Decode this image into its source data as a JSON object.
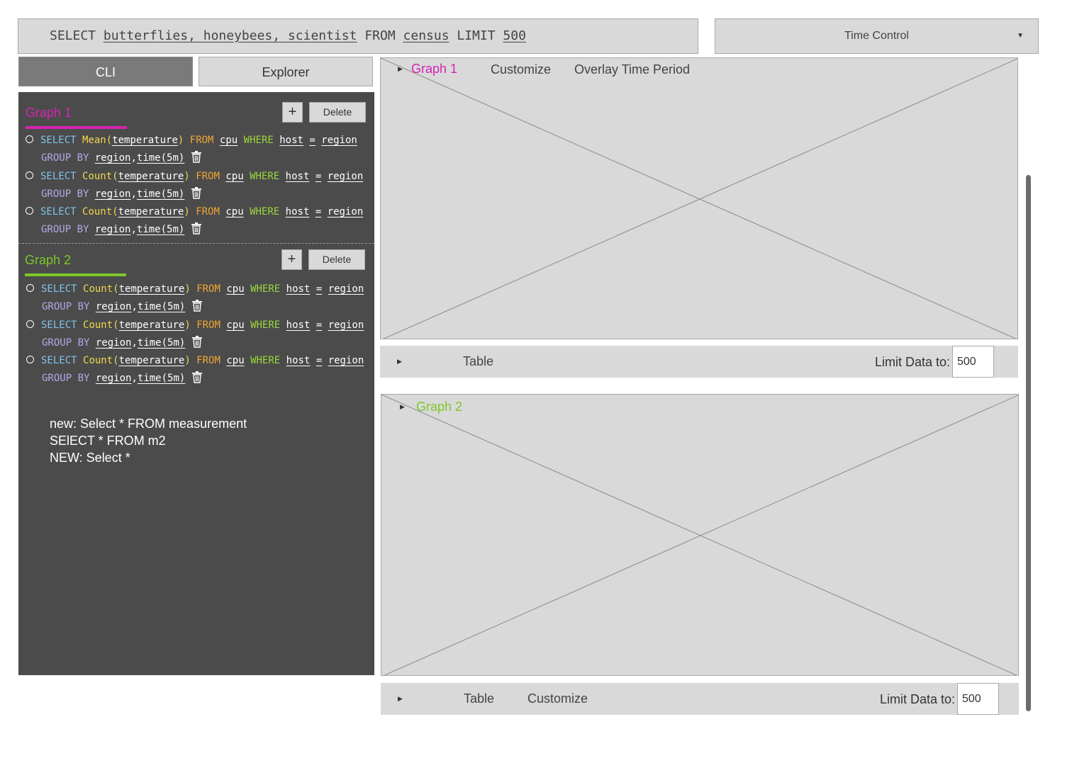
{
  "query_bar": {
    "parts": [
      "SELECT ",
      "butterflies, honeybees, scientist",
      " FROM ",
      "census",
      " LIMIT ",
      "500"
    ]
  },
  "time_control": {
    "label": "Time Control",
    "icon": "caret-down-icon"
  },
  "tabs": {
    "cli": "CLI",
    "explorer": "Explorer"
  },
  "colors": {
    "graph1": "#d424b4",
    "graph2": "#7cc828",
    "panel_bg": "#4b4b4b"
  },
  "cli": {
    "add_label": "+",
    "delete_label": "Delete",
    "groups": [
      {
        "title": "Graph 1",
        "queries": [
          {
            "select": "SELECT",
            "fn": "Mean(",
            "field": "temperature",
            "close": ")",
            "from": "FROM",
            "measurement": "cpu",
            "where": "WHERE",
            "tag": "host",
            "op": "=",
            "value": "region",
            "group": "GROUP BY",
            "g1": "region",
            "comma": ",",
            "g2": "time(5m)"
          },
          {
            "select": "SELECT",
            "fn": "Count(",
            "field": "temperature",
            "close": ")",
            "from": "FROM",
            "measurement": "cpu",
            "where": "WHERE",
            "tag": "host",
            "op": "=",
            "value": "region",
            "group": "GROUP BY",
            "g1": "region",
            "comma": ",",
            "g2": "time(5m)"
          },
          {
            "select": "SELECT",
            "fn": "Count(",
            "field": "temperature",
            "close": ")",
            "from": "FROM",
            "measurement": "cpu",
            "where": "WHERE",
            "tag": "host",
            "op": "=",
            "value": "region",
            "group": "GROUP BY",
            "g1": "region",
            "comma": ",",
            "g2": "time(5m)"
          }
        ]
      },
      {
        "title": "Graph 2",
        "queries": [
          {
            "select": "SELECT",
            "fn": "Count(",
            "field": "temperature",
            "close": ")",
            "from": "FROM",
            "measurement": "cpu",
            "where": "WHERE",
            "tag": "host",
            "op": "=",
            "value": "region",
            "group": "GROUP BY",
            "g1": "region",
            "comma": ",",
            "g2": "time(5m)"
          },
          {
            "select": "SELECT",
            "fn": "Count(",
            "field": "temperature",
            "close": ")",
            "from": "FROM",
            "measurement": "cpu",
            "where": "WHERE",
            "tag": "host",
            "op": "=",
            "value": "region",
            "group": "GROUP BY",
            "g1": "region",
            "comma": ",",
            "g2": "time(5m)"
          },
          {
            "select": "SELECT",
            "fn": "Count(",
            "field": "temperature",
            "close": ")",
            "from": "FROM",
            "measurement": "cpu",
            "where": "WHERE",
            "tag": "host",
            "op": "=",
            "value": "region",
            "group": "GROUP BY",
            "g1": "region",
            "comma": ",",
            "g2": "time(5m)"
          }
        ]
      }
    ],
    "history": [
      "new: Select * FROM measurement",
      "SElECT * FROM m2",
      "NEW: Select *"
    ]
  },
  "graphs": [
    {
      "title": "Graph 1",
      "customize": "Customize",
      "overlay": "Overlay Time Period",
      "table": "Table",
      "limit_label": "Limit Data to:",
      "limit_value": "500"
    },
    {
      "title": "Graph 2",
      "table": "Table",
      "customize": "Customize",
      "limit_label": "Limit Data to:",
      "limit_value": "500"
    }
  ]
}
